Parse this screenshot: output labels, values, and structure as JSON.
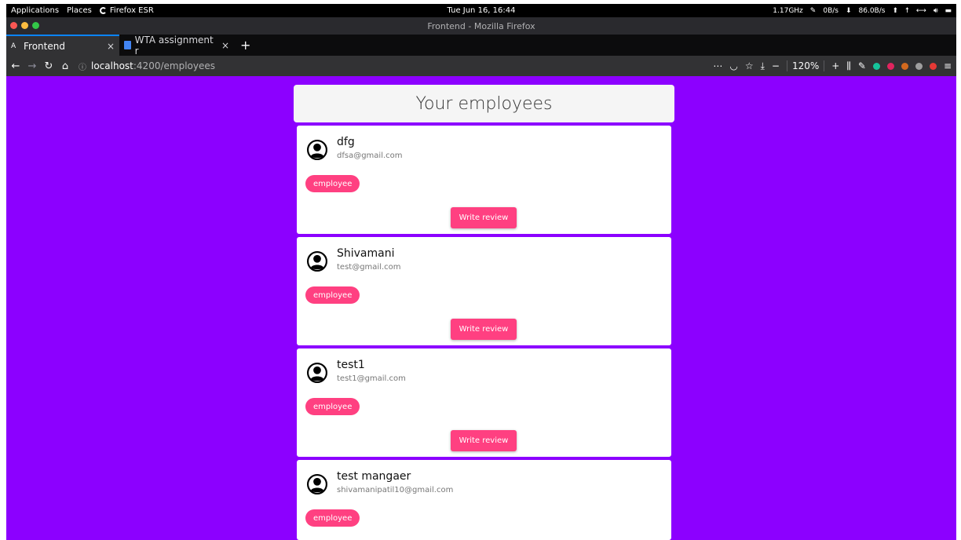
{
  "system_bar": {
    "applications": "Applications",
    "places": "Places",
    "browser_app": "Firefox ESR",
    "clock": "Tue Jun 16, 16:44",
    "cpu": "1.17GHz",
    "net_up": "0B/s",
    "net_down": "86.0B/s"
  },
  "window": {
    "title": "Frontend - Mozilla Firefox"
  },
  "tabs": [
    {
      "label": "Frontend",
      "favicon": "A"
    },
    {
      "label": "WTA assignment r"
    }
  ],
  "navbar": {
    "url_host": "localhost",
    "url_path": ":4200/employees",
    "zoom": "120%"
  },
  "page": {
    "heading": "Your employees",
    "review_label": "Write review",
    "employees": [
      {
        "name": "dfg",
        "email": "dfsa@gmail.com",
        "role": "employee"
      },
      {
        "name": "Shivamani",
        "email": "test@gmail.com",
        "role": "employee"
      },
      {
        "name": "test1",
        "email": "test1@gmail.com",
        "role": "employee"
      },
      {
        "name": "test mangaer",
        "email": "shivamanipatil10@gmail.com",
        "role": "employee"
      }
    ]
  },
  "colors": {
    "page_background": "#8c00ff",
    "accent": "#ff4081",
    "tab_highlight": "#0a84ff"
  }
}
